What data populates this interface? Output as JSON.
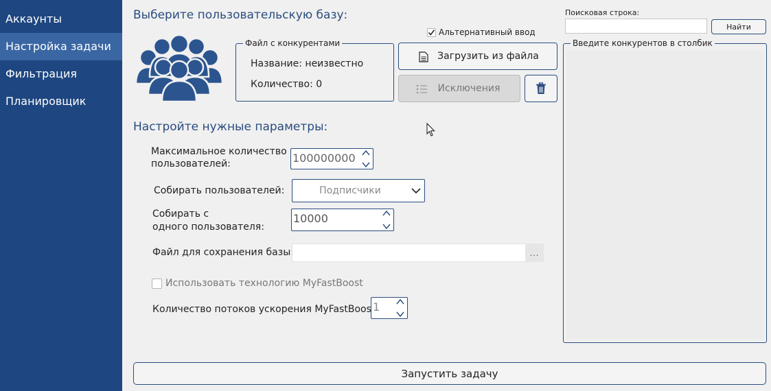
{
  "sidebar": {
    "items": [
      {
        "label": "Аккаунты"
      },
      {
        "label": "Настройка задачи"
      },
      {
        "label": "Фильтрация"
      },
      {
        "label": "Планировщик"
      }
    ],
    "active_index": 1
  },
  "base": {
    "title": "Выберите пользовательскую базу:",
    "competitors_group": {
      "legend": "Файл с конкурентами",
      "name_text": "Название: неизвестно",
      "count_text": "Количество: 0"
    },
    "alt_input_label": "Альтернативный ввод",
    "alt_input_checked": true,
    "load_button": "Загрузить из файла",
    "exclusions_button": "Исключения"
  },
  "params": {
    "title": "Настройте нужные параметры:",
    "max_users_label_1": "Максимальное количество",
    "max_users_label_2": "пользователей:",
    "max_users_value": "100000000",
    "collect_label": "Собирать пользователей:",
    "collect_value": "Подписчики",
    "per_user_label_1": "Собирать с",
    "per_user_label_2": "одного пользователя:",
    "per_user_value": "10000",
    "save_file_label": "Файл для сохранения базы:",
    "save_file_value": "",
    "browse_label": "...",
    "myfastboost_label": "Использовать технологию MyFastBoost",
    "myfastboost_checked": false,
    "threads_label": "Количество потоков ускорения MyFastBoost:",
    "threads_value": "1"
  },
  "search": {
    "label": "Поисковая строка:",
    "value": "",
    "button": "Найти"
  },
  "competitors_column": {
    "legend": "Введите конкурентов в столбик",
    "value": ""
  },
  "run_button": "Запустить задачу",
  "colors": {
    "sidebar": "#1e4680",
    "sidebar_active": "#3a66a3",
    "accent": "#2a4c7f",
    "icon": "#2c558f"
  }
}
